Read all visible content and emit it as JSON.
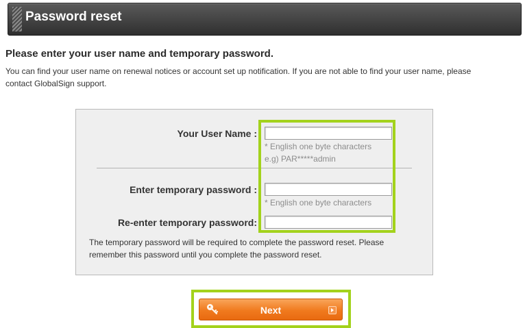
{
  "header": {
    "title": "Password reset"
  },
  "intro": {
    "heading": "Please enter your user name and temporary password.",
    "description": "You can find your user name on renewal notices or account set up notification. If you are not able to find your user name, please contact GlobalSign support."
  },
  "form": {
    "username": {
      "label": "Your User Name :",
      "value": "",
      "hint1": "* English one byte characters",
      "hint2": "e.g) PAR*****admin"
    },
    "temp_password": {
      "label": "Enter temporary password :",
      "value": "",
      "hint": "* English one byte characters"
    },
    "reenter_password": {
      "label": "Re-enter temporary password:",
      "value": ""
    },
    "note": "The temporary password will be required to complete the password reset. Please remember this password until you complete the password reset."
  },
  "actions": {
    "next_label": "Next"
  },
  "colors": {
    "highlight": "#a3d21c",
    "button": "#f07a1e",
    "header": "#3a3a3a"
  },
  "icons": {
    "button_left": "key-icon",
    "button_right": "arrow-right-icon"
  }
}
